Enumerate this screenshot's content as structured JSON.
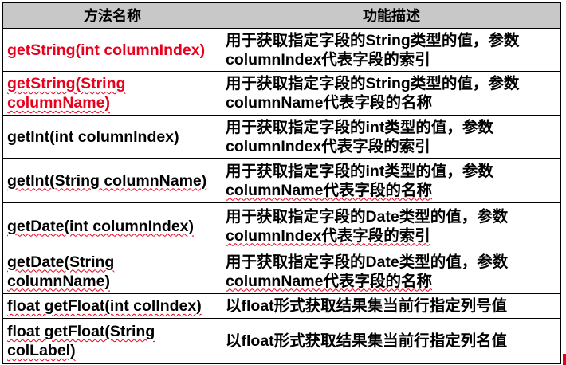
{
  "header": {
    "method_col": "方法名称",
    "desc_col": "功能描述"
  },
  "rows": [
    {
      "method_parts": [
        "getString(int columnIndex)"
      ],
      "desc_lines": [
        "用于获取指定字段的String类型的值，参数",
        "columnIndex代表字段的索引"
      ]
    },
    {
      "method_parts": [
        "getString(String",
        "columnName)"
      ],
      "desc_lines": [
        "用于获取指定字段的String类型的值，参数",
        "columnName代表字段的名称"
      ]
    },
    {
      "method_parts": [
        "getInt(int columnIndex)"
      ],
      "desc_lines": [
        "用于获取指定字段的int类型的值，参数",
        "columnIndex代表字段的索引"
      ]
    },
    {
      "method_parts": [
        "getInt(String columnName)"
      ],
      "desc_lines": [
        "用于获取指定字段的int类型的值，参数",
        "columnName代表字段的名称"
      ]
    },
    {
      "method_parts": [
        "getDate(int columnIndex)"
      ],
      "desc_lines": [
        "用于获取指定字段的Date类型的值，参数",
        "columnIndex代表字段的索引"
      ]
    },
    {
      "method_parts": [
        "getDate(String",
        "columnName)"
      ],
      "desc_lines": [
        "用于获取指定字段的Date类型的值，参数",
        "columnName代表字段的名称"
      ]
    },
    {
      "method_parts": [
        "float getFloat(int colIndex)"
      ],
      "desc_lines": [
        "以float形式获取结果集当前行指定列号值"
      ]
    },
    {
      "method_parts": [
        "float getFloat(String",
        "colLabel)"
      ],
      "desc_lines": [
        "以float形式获取结果集当前行指定列名值"
      ]
    }
  ],
  "colors": {
    "header_bg": "#c8c8c8",
    "highlight_red": "#e8001c",
    "text": "#000000",
    "border": "#000000"
  }
}
